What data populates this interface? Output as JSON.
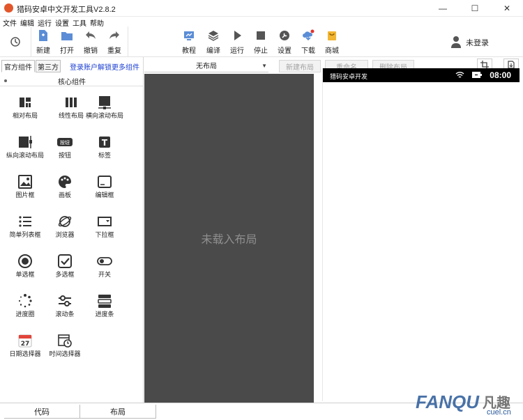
{
  "window": {
    "title": "猎码安卓中文开发工具V2.8.2",
    "minimize": "—",
    "maximize": "☐",
    "close": "✕"
  },
  "menu": [
    "文件",
    "编辑",
    "运行",
    "设置",
    "工具",
    "帮助"
  ],
  "toolbar_left": [
    {
      "label": "新建",
      "icon": "new-file-icon"
    },
    {
      "label": "打开",
      "icon": "folder-icon"
    },
    {
      "label": "撤销",
      "icon": "undo-icon"
    },
    {
      "label": "重复",
      "icon": "redo-icon"
    }
  ],
  "toolbar_center": [
    {
      "label": "教程",
      "icon": "tutorial-icon"
    },
    {
      "label": "编译",
      "icon": "layers-icon"
    },
    {
      "label": "运行",
      "icon": "play-icon"
    },
    {
      "label": "停止",
      "icon": "stop-icon"
    },
    {
      "label": "设置",
      "icon": "wrench-icon"
    },
    {
      "label": "下载",
      "icon": "cloud-download-icon"
    },
    {
      "label": "商城",
      "icon": "store-icon"
    }
  ],
  "user": {
    "label": "未登录",
    "icon": "user-icon"
  },
  "sidebar": {
    "tabs": [
      "官方组件",
      "第三方"
    ],
    "login_link": "登录账户解锁更多组件",
    "section_title": "核心组件",
    "components": [
      {
        "label": "相对布局",
        "icon": "relative-layout-icon"
      },
      {
        "label": "线性布局",
        "icon": "linear-layout-icon"
      },
      {
        "label": "横向滚动布局",
        "icon": "horizontal-scroll-icon"
      },
      {
        "label": "纵向滚动布局",
        "icon": "vertical-scroll-icon"
      },
      {
        "label": "按钮",
        "icon": "button-icon",
        "icon_text": "按钮"
      },
      {
        "label": "标签",
        "icon": "label-icon",
        "icon_text": "T"
      },
      {
        "label": "图片框",
        "icon": "image-icon"
      },
      {
        "label": "画板",
        "icon": "palette-icon"
      },
      {
        "label": "编辑框",
        "icon": "edit-box-icon"
      },
      {
        "label": "简单列表框",
        "icon": "list-icon"
      },
      {
        "label": "浏览器",
        "icon": "browser-icon"
      },
      {
        "label": "下拉框",
        "icon": "dropdown-icon"
      },
      {
        "label": "单选框",
        "icon": "radio-icon"
      },
      {
        "label": "多选框",
        "icon": "checkbox-icon"
      },
      {
        "label": "开关",
        "icon": "switch-icon"
      },
      {
        "label": "进度圈",
        "icon": "progress-ring-icon"
      },
      {
        "label": "滚动条",
        "icon": "slider-icon"
      },
      {
        "label": "进度条",
        "icon": "progress-bar-icon"
      },
      {
        "label": "日期选择器",
        "icon": "calendar-icon",
        "icon_text": "27"
      },
      {
        "label": "时间选择器",
        "icon": "time-picker-icon"
      }
    ]
  },
  "layout_panel": {
    "selected_layout": "无布局",
    "empty_text": "未载入布局",
    "buttons": [
      "新建布局",
      "重命名",
      "删除布局"
    ]
  },
  "phone": {
    "title": "猎码安卓开发",
    "time": "08:00"
  },
  "bottom_tabs": [
    "代码",
    "布局"
  ],
  "watermark": {
    "text": "FANQU",
    "suffix": "凡趣",
    "site": "cuel.cn"
  }
}
